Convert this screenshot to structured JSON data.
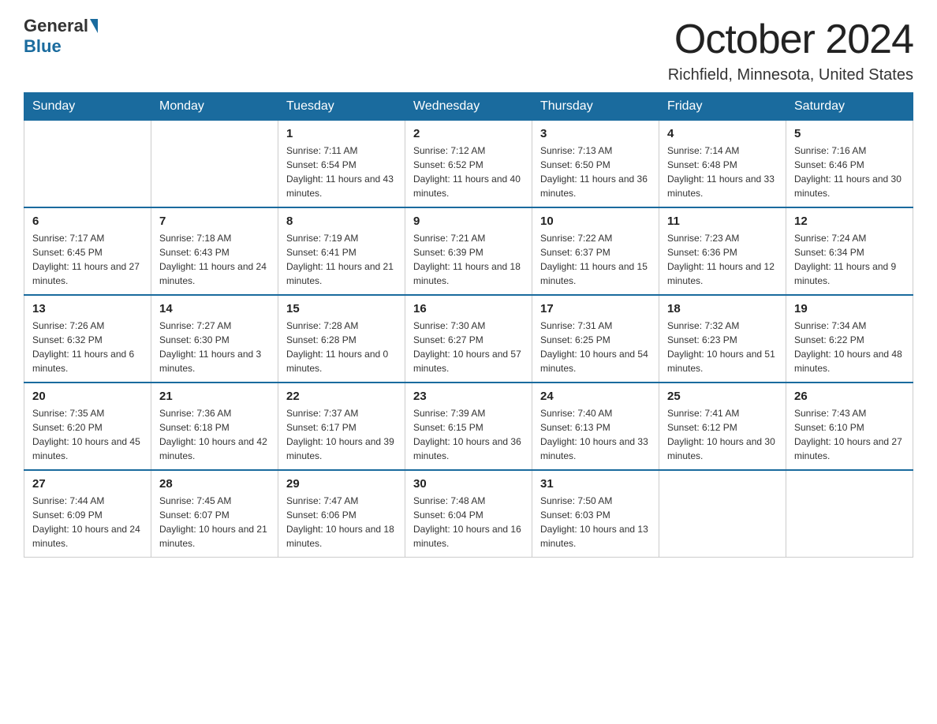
{
  "header": {
    "logo_general": "General",
    "logo_blue": "Blue",
    "month_title": "October 2024",
    "location": "Richfield, Minnesota, United States"
  },
  "days_of_week": [
    "Sunday",
    "Monday",
    "Tuesday",
    "Wednesday",
    "Thursday",
    "Friday",
    "Saturday"
  ],
  "weeks": [
    [
      {
        "day": "",
        "sunrise": "",
        "sunset": "",
        "daylight": ""
      },
      {
        "day": "",
        "sunrise": "",
        "sunset": "",
        "daylight": ""
      },
      {
        "day": "1",
        "sunrise": "Sunrise: 7:11 AM",
        "sunset": "Sunset: 6:54 PM",
        "daylight": "Daylight: 11 hours and 43 minutes."
      },
      {
        "day": "2",
        "sunrise": "Sunrise: 7:12 AM",
        "sunset": "Sunset: 6:52 PM",
        "daylight": "Daylight: 11 hours and 40 minutes."
      },
      {
        "day": "3",
        "sunrise": "Sunrise: 7:13 AM",
        "sunset": "Sunset: 6:50 PM",
        "daylight": "Daylight: 11 hours and 36 minutes."
      },
      {
        "day": "4",
        "sunrise": "Sunrise: 7:14 AM",
        "sunset": "Sunset: 6:48 PM",
        "daylight": "Daylight: 11 hours and 33 minutes."
      },
      {
        "day": "5",
        "sunrise": "Sunrise: 7:16 AM",
        "sunset": "Sunset: 6:46 PM",
        "daylight": "Daylight: 11 hours and 30 minutes."
      }
    ],
    [
      {
        "day": "6",
        "sunrise": "Sunrise: 7:17 AM",
        "sunset": "Sunset: 6:45 PM",
        "daylight": "Daylight: 11 hours and 27 minutes."
      },
      {
        "day": "7",
        "sunrise": "Sunrise: 7:18 AM",
        "sunset": "Sunset: 6:43 PM",
        "daylight": "Daylight: 11 hours and 24 minutes."
      },
      {
        "day": "8",
        "sunrise": "Sunrise: 7:19 AM",
        "sunset": "Sunset: 6:41 PM",
        "daylight": "Daylight: 11 hours and 21 minutes."
      },
      {
        "day": "9",
        "sunrise": "Sunrise: 7:21 AM",
        "sunset": "Sunset: 6:39 PM",
        "daylight": "Daylight: 11 hours and 18 minutes."
      },
      {
        "day": "10",
        "sunrise": "Sunrise: 7:22 AM",
        "sunset": "Sunset: 6:37 PM",
        "daylight": "Daylight: 11 hours and 15 minutes."
      },
      {
        "day": "11",
        "sunrise": "Sunrise: 7:23 AM",
        "sunset": "Sunset: 6:36 PM",
        "daylight": "Daylight: 11 hours and 12 minutes."
      },
      {
        "day": "12",
        "sunrise": "Sunrise: 7:24 AM",
        "sunset": "Sunset: 6:34 PM",
        "daylight": "Daylight: 11 hours and 9 minutes."
      }
    ],
    [
      {
        "day": "13",
        "sunrise": "Sunrise: 7:26 AM",
        "sunset": "Sunset: 6:32 PM",
        "daylight": "Daylight: 11 hours and 6 minutes."
      },
      {
        "day": "14",
        "sunrise": "Sunrise: 7:27 AM",
        "sunset": "Sunset: 6:30 PM",
        "daylight": "Daylight: 11 hours and 3 minutes."
      },
      {
        "day": "15",
        "sunrise": "Sunrise: 7:28 AM",
        "sunset": "Sunset: 6:28 PM",
        "daylight": "Daylight: 11 hours and 0 minutes."
      },
      {
        "day": "16",
        "sunrise": "Sunrise: 7:30 AM",
        "sunset": "Sunset: 6:27 PM",
        "daylight": "Daylight: 10 hours and 57 minutes."
      },
      {
        "day": "17",
        "sunrise": "Sunrise: 7:31 AM",
        "sunset": "Sunset: 6:25 PM",
        "daylight": "Daylight: 10 hours and 54 minutes."
      },
      {
        "day": "18",
        "sunrise": "Sunrise: 7:32 AM",
        "sunset": "Sunset: 6:23 PM",
        "daylight": "Daylight: 10 hours and 51 minutes."
      },
      {
        "day": "19",
        "sunrise": "Sunrise: 7:34 AM",
        "sunset": "Sunset: 6:22 PM",
        "daylight": "Daylight: 10 hours and 48 minutes."
      }
    ],
    [
      {
        "day": "20",
        "sunrise": "Sunrise: 7:35 AM",
        "sunset": "Sunset: 6:20 PM",
        "daylight": "Daylight: 10 hours and 45 minutes."
      },
      {
        "day": "21",
        "sunrise": "Sunrise: 7:36 AM",
        "sunset": "Sunset: 6:18 PM",
        "daylight": "Daylight: 10 hours and 42 minutes."
      },
      {
        "day": "22",
        "sunrise": "Sunrise: 7:37 AM",
        "sunset": "Sunset: 6:17 PM",
        "daylight": "Daylight: 10 hours and 39 minutes."
      },
      {
        "day": "23",
        "sunrise": "Sunrise: 7:39 AM",
        "sunset": "Sunset: 6:15 PM",
        "daylight": "Daylight: 10 hours and 36 minutes."
      },
      {
        "day": "24",
        "sunrise": "Sunrise: 7:40 AM",
        "sunset": "Sunset: 6:13 PM",
        "daylight": "Daylight: 10 hours and 33 minutes."
      },
      {
        "day": "25",
        "sunrise": "Sunrise: 7:41 AM",
        "sunset": "Sunset: 6:12 PM",
        "daylight": "Daylight: 10 hours and 30 minutes."
      },
      {
        "day": "26",
        "sunrise": "Sunrise: 7:43 AM",
        "sunset": "Sunset: 6:10 PM",
        "daylight": "Daylight: 10 hours and 27 minutes."
      }
    ],
    [
      {
        "day": "27",
        "sunrise": "Sunrise: 7:44 AM",
        "sunset": "Sunset: 6:09 PM",
        "daylight": "Daylight: 10 hours and 24 minutes."
      },
      {
        "day": "28",
        "sunrise": "Sunrise: 7:45 AM",
        "sunset": "Sunset: 6:07 PM",
        "daylight": "Daylight: 10 hours and 21 minutes."
      },
      {
        "day": "29",
        "sunrise": "Sunrise: 7:47 AM",
        "sunset": "Sunset: 6:06 PM",
        "daylight": "Daylight: 10 hours and 18 minutes."
      },
      {
        "day": "30",
        "sunrise": "Sunrise: 7:48 AM",
        "sunset": "Sunset: 6:04 PM",
        "daylight": "Daylight: 10 hours and 16 minutes."
      },
      {
        "day": "31",
        "sunrise": "Sunrise: 7:50 AM",
        "sunset": "Sunset: 6:03 PM",
        "daylight": "Daylight: 10 hours and 13 minutes."
      },
      {
        "day": "",
        "sunrise": "",
        "sunset": "",
        "daylight": ""
      },
      {
        "day": "",
        "sunrise": "",
        "sunset": "",
        "daylight": ""
      }
    ]
  ]
}
